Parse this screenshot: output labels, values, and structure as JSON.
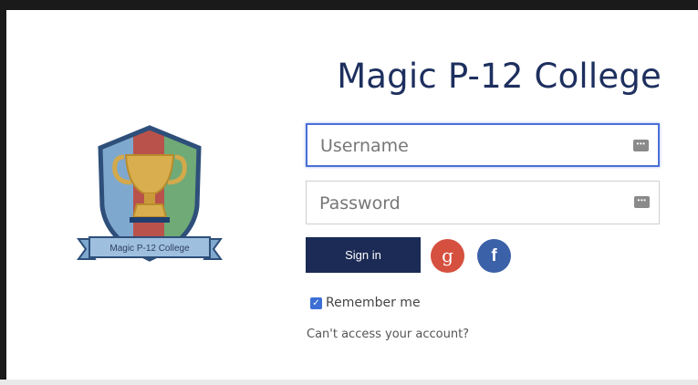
{
  "brand": {
    "college_name": "Magic P-12 College",
    "logo_banner_text": "Magic P-12 College"
  },
  "form": {
    "username": {
      "value": "",
      "placeholder": "Username",
      "icon": "keyboard-icon",
      "focused": true
    },
    "password": {
      "value": "",
      "placeholder": "Password",
      "icon": "keyboard-icon"
    },
    "signin_label": "Sign in",
    "google_label": "g",
    "facebook_label": "f",
    "remember_me": {
      "label": "Remember me",
      "checked": true
    },
    "help_link": "Can't access your account?"
  },
  "colors": {
    "title": "#1d2f5e",
    "signin_button": "#1b2b55",
    "google": "#d6503f",
    "facebook": "#3b61a8",
    "focus_border": "#4a6fd8"
  }
}
